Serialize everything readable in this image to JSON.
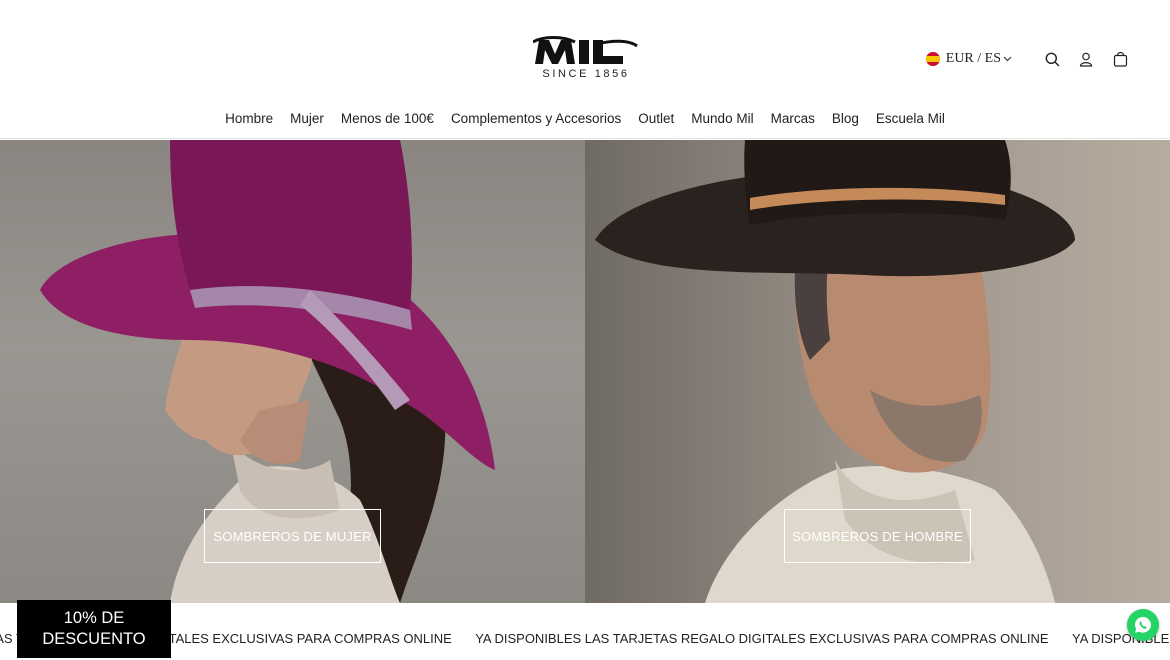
{
  "brand": {
    "name": "MIL",
    "tagline": "SINCE 1856"
  },
  "locale": {
    "currency_label": "EUR / ES",
    "flag_icon": "spain-flag-icon"
  },
  "tools": {
    "search_icon": "search-icon",
    "account_icon": "user-icon",
    "cart_icon": "bag-icon"
  },
  "nav": {
    "items": [
      "Hombre",
      "Mujer",
      "Menos de 100€",
      "Complementos y Accesorios",
      "Outlet",
      "Mundo Mil",
      "Marcas",
      "Blog",
      "Escuela Mil"
    ]
  },
  "hero": {
    "left_button": "SOMBREROS DE MUJER",
    "right_button": "SOMBREROS DE HOMBRE"
  },
  "ticker": {
    "pieces": [
      "LAS TARJETAS REGALO DIGITALES EXCLUSIVAS PARA COMPRAS ONLINE",
      "YA DISPONIBLES LAS TARJETAS REGALO DIGITALES EXCLUSIVAS PARA COMPRAS ONLINE",
      "YA DISPONIBLES LAS TARJETAS REGALO DIGITALES EXCLUSIVAS PARA COMPRAS ONLINE"
    ]
  },
  "promo": {
    "line1": "10% DE",
    "line2": "DESCUENTO"
  },
  "colors": {
    "accent": "#000000",
    "whatsapp": "#25d366",
    "hat_women": "#8e1f64"
  }
}
